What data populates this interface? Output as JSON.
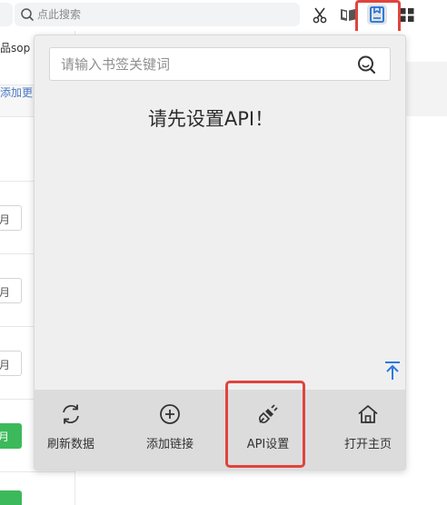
{
  "toolbar": {
    "search_placeholder": "点此搜索",
    "icons": [
      "scissors-icon",
      "book-icon",
      "bookmark-icon",
      "grid-icon"
    ]
  },
  "background_page": {
    "label_1": "品sop",
    "label_2": "添加更",
    "input_tails": [
      "月",
      "月",
      "月"
    ],
    "green_tails": [
      "月"
    ]
  },
  "popup": {
    "search_placeholder": "请输入书签关键词",
    "message": "请先设置API！",
    "bottom_nav": [
      {
        "label": "刷新数据",
        "icon": "refresh-icon"
      },
      {
        "label": "添加链接",
        "icon": "add-circle-icon"
      },
      {
        "label": "API设置",
        "icon": "plug-icon"
      },
      {
        "label": "打开主页",
        "icon": "home-icon"
      }
    ]
  },
  "colors": {
    "highlight": "#e0443d",
    "accent": "#2a7ae2",
    "popup_bg": "#efefef",
    "bottom_bar_bg": "#dcdcdc",
    "green": "#3cb95a"
  }
}
